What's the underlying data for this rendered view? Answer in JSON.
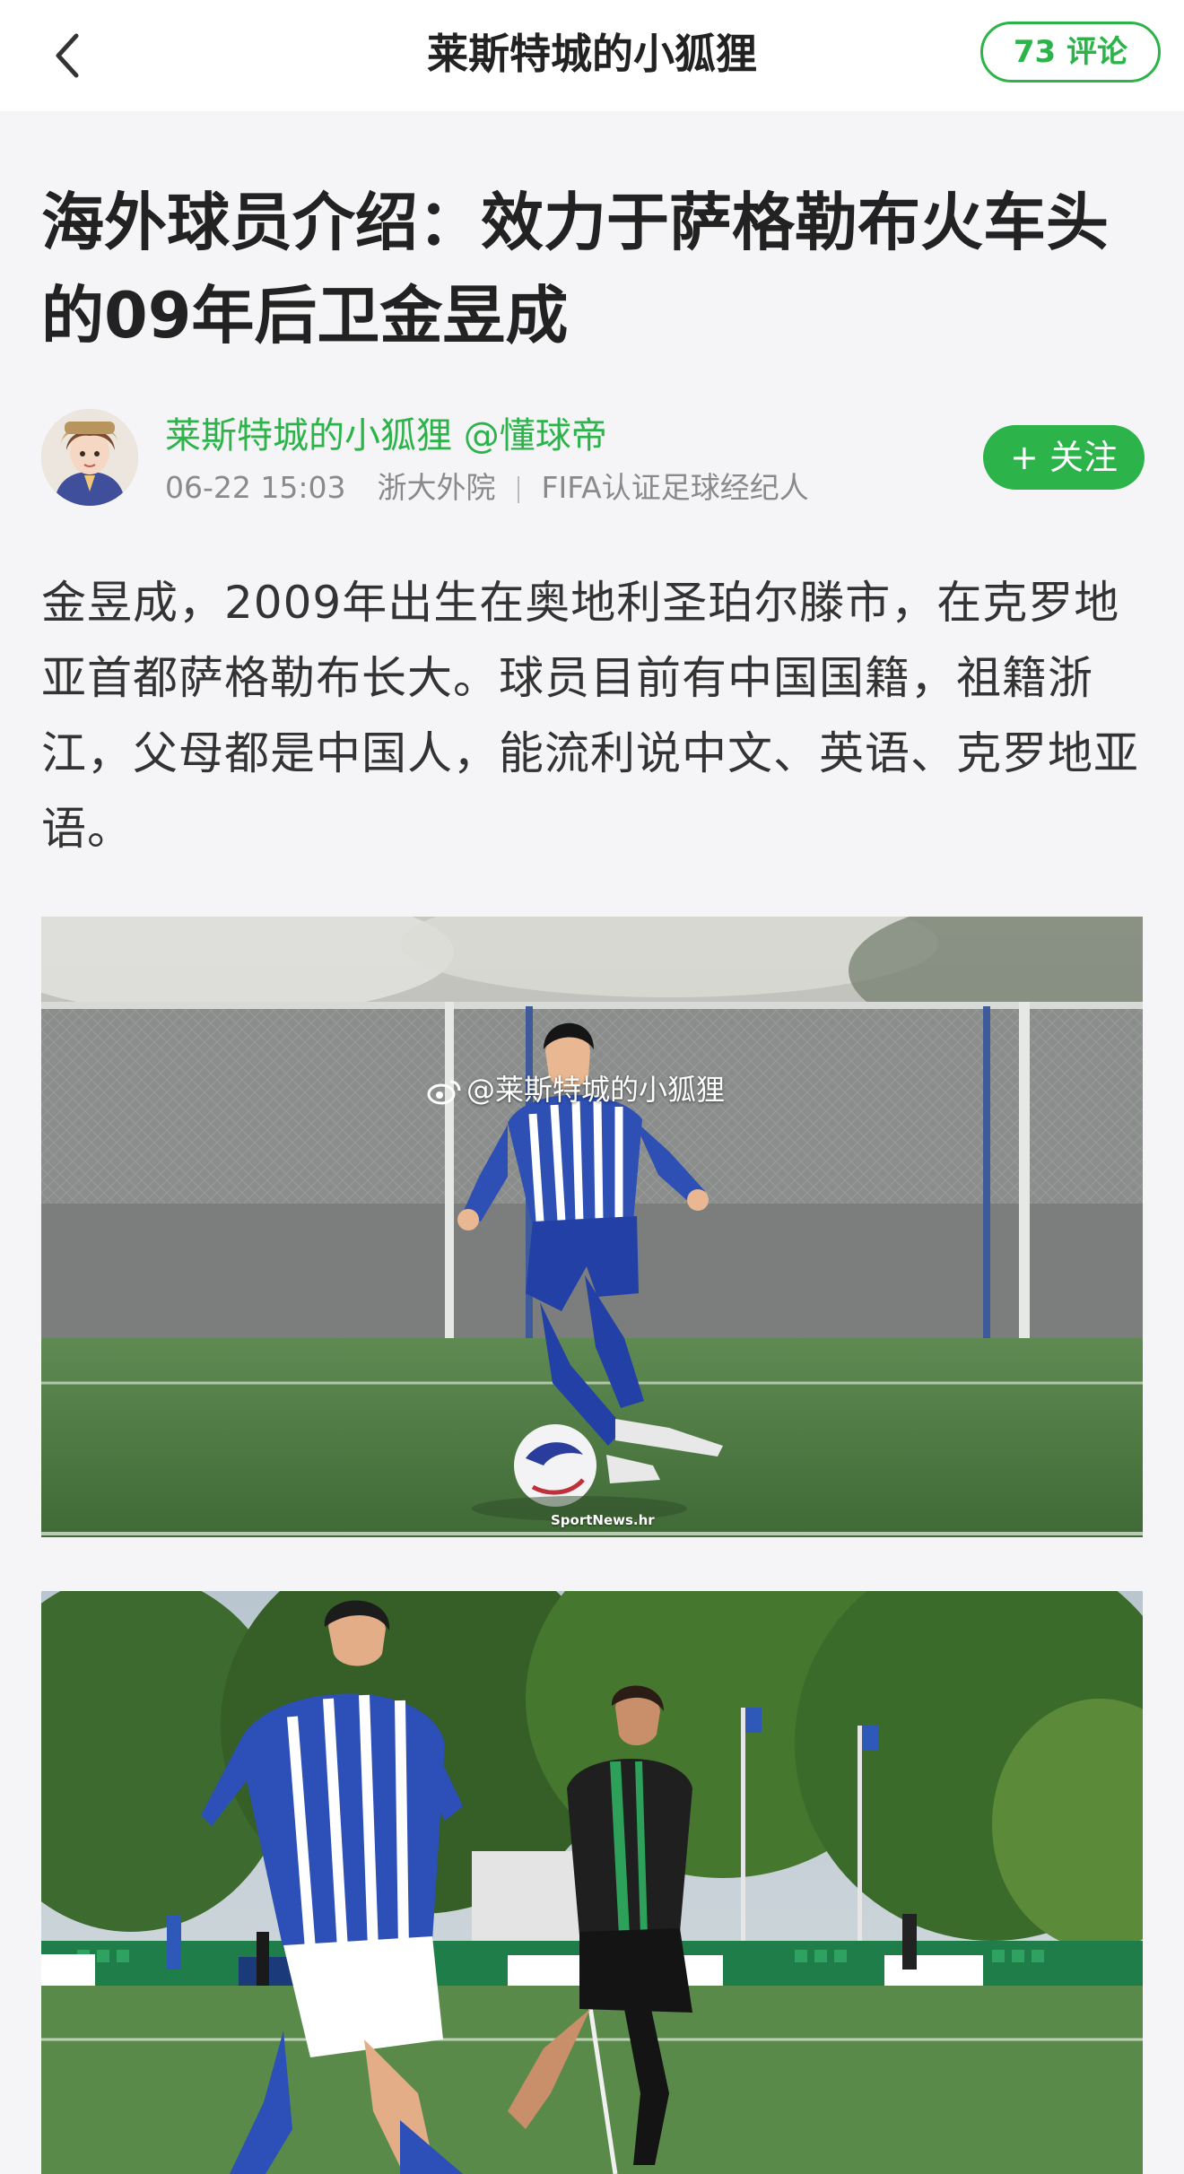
{
  "header": {
    "title": "莱斯特城的小狐狸",
    "comments_label": "73 评论"
  },
  "article": {
    "title": "海外球员介绍：效力于萨格勒布火车头的09年后卫金昱成",
    "author": {
      "name": "莱斯特城的小狐狸 @懂球帝",
      "date": "06-22 15:03",
      "school": "浙大外院",
      "title": "FIFA认证足球经纪人",
      "follow_label": "+ 关注"
    },
    "body": "金昱成，2009年出生在奥地利圣珀尔滕市，在克罗地亚首都萨格勒布长大。球员目前有中国国籍，祖籍浙江，父母都是中国人，能流利说中文、英语、克罗地亚语。",
    "images": [
      {
        "watermark": "@莱斯特城的小狐狸",
        "credit": "SportNews.hr"
      },
      {}
    ]
  },
  "colors": {
    "accent": "#2cb34a",
    "page_bg": "#f5f5f7"
  },
  "icons": {
    "back": "chevron-left-icon",
    "weibo": "weibo-logo-icon"
  }
}
